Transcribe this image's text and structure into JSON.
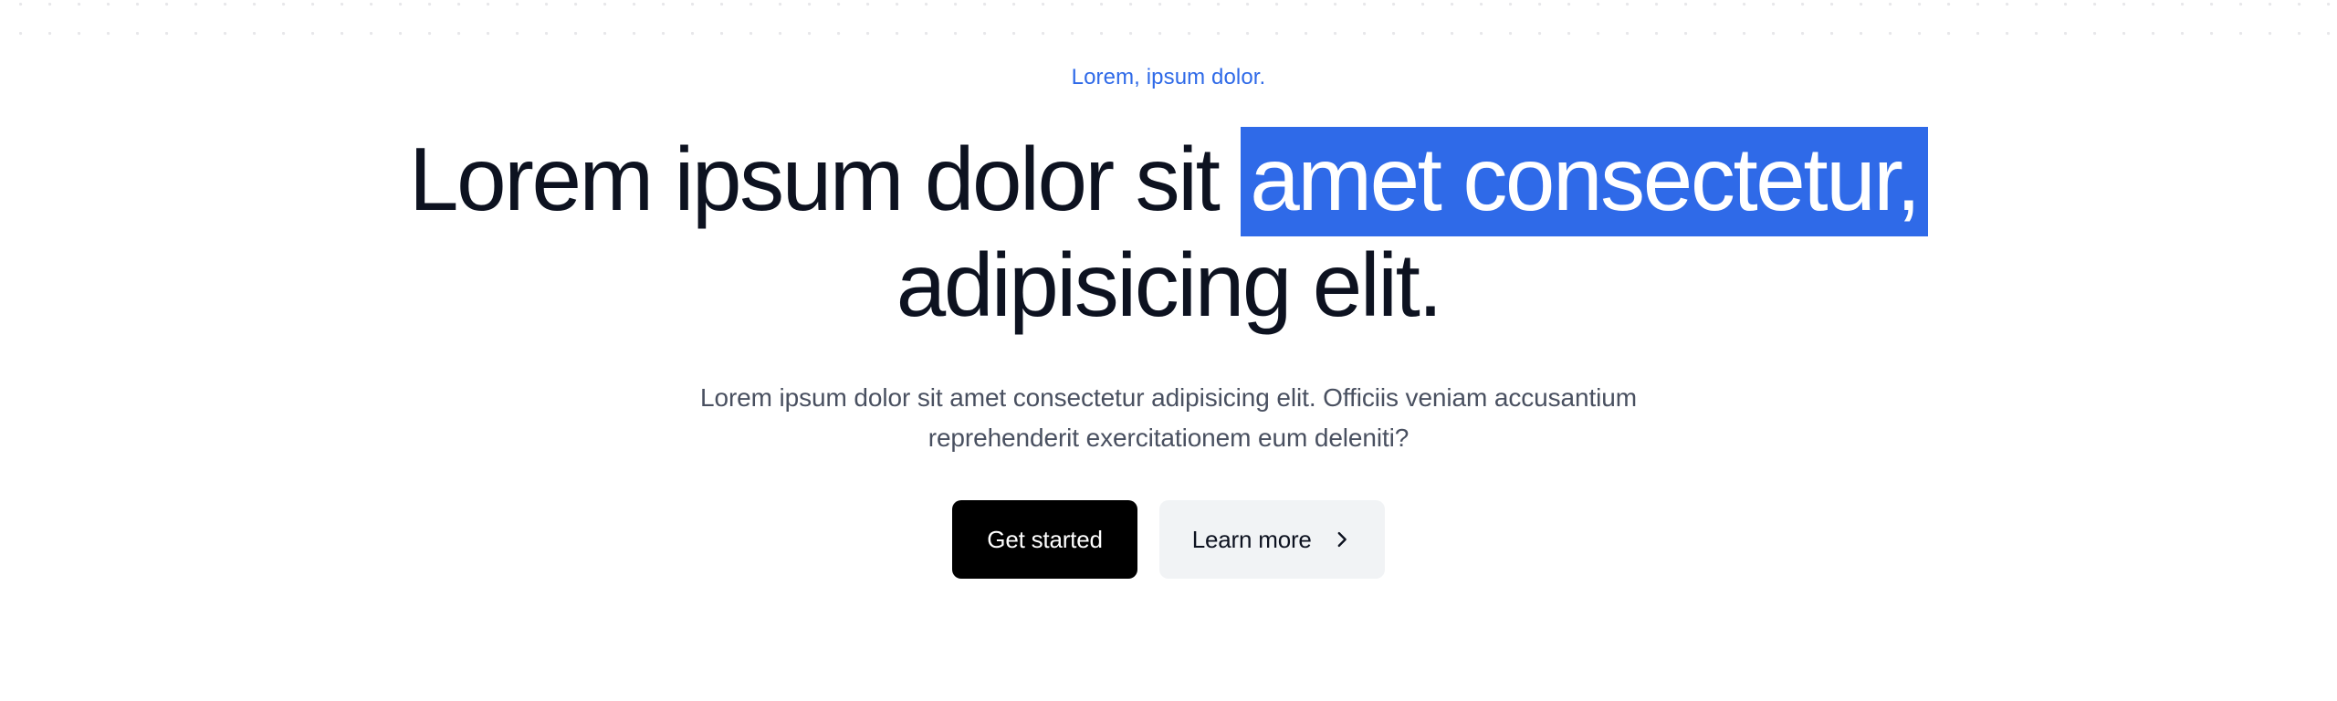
{
  "hero": {
    "eyebrow": "Lorem, ipsum dolor.",
    "heading": {
      "part_before": "Lorem ipsum dolor sit ",
      "highlight": "amet consectetur,",
      "part_after": " adipisicing elit."
    },
    "subcopy": "Lorem ipsum dolor sit amet consectetur adipisicing elit. Officiis veniam accusantium reprehenderit exercitationem eum deleniti?",
    "cta": {
      "primary_label": "Get started",
      "secondary_label": "Learn more",
      "secondary_icon": "chevron-right-icon"
    },
    "colors": {
      "accent_blue": "#2f6ae8",
      "heading_ink": "#0d1220",
      "body_gray": "#495060",
      "primary_button_bg": "#000000",
      "primary_button_text": "#ffffff",
      "secondary_button_bg": "#f1f3f5",
      "secondary_button_text": "#0d1220",
      "page_bg": "#ffffff",
      "dot_grid": "#e7e7ea"
    }
  }
}
